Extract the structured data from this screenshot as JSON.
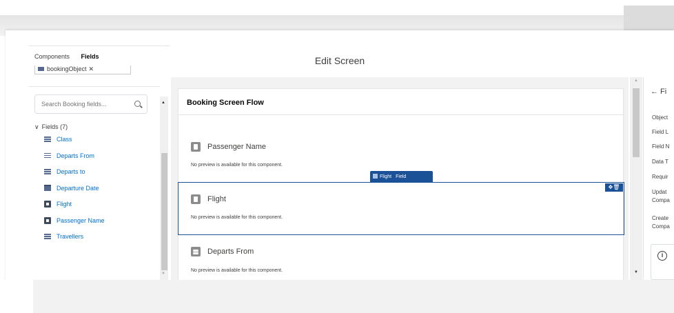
{
  "modal": {
    "title": "Edit Screen"
  },
  "palette": {
    "tabs": [
      {
        "label": "Components",
        "active": false
      },
      {
        "label": "Fields",
        "active": true
      }
    ],
    "object_pill": {
      "label": "bookingObject",
      "remove": "✕"
    },
    "search": {
      "placeholder": "Search Booking fields...",
      "icon": "search-icon"
    },
    "section": {
      "label": "Fields (7)",
      "chevron": "∨"
    },
    "fields": [
      {
        "label": "Class",
        "icon": "list-icon"
      },
      {
        "label": "Departs From",
        "icon": "list-icon"
      },
      {
        "label": "Departs to",
        "icon": "list-icon"
      },
      {
        "label": "Departure Date",
        "icon": "calendar-icon"
      },
      {
        "label": "Flight",
        "icon": "text-field-icon"
      },
      {
        "label": "Passenger Name",
        "icon": "text-field-icon"
      },
      {
        "label": "Travellers",
        "icon": "list-icon"
      }
    ]
  },
  "canvas": {
    "title": "Booking Screen Flow",
    "components": [
      {
        "label": "Passenger Name",
        "note": "No preview is available for this component."
      },
      {
        "label": "Flight",
        "note": "No preview is available for this component."
      },
      {
        "label": "Departs From",
        "note": "No preview is available for this component."
      }
    ],
    "selected_badge": {
      "name": "Flight",
      "type": "Field"
    },
    "tools": {
      "move": "✥",
      "delete": "🗑"
    }
  },
  "properties": {
    "back_label": "← Fi",
    "rows": [
      "Object",
      "Field L",
      "Field N",
      "Data T",
      "Requir",
      "Updat",
      "Compa",
      "Create",
      "Compa"
    ],
    "info": "i"
  },
  "colors": {
    "accent": "#0070d2",
    "selection": "#1b5297",
    "canvas_bg": "#f3f2f2"
  }
}
